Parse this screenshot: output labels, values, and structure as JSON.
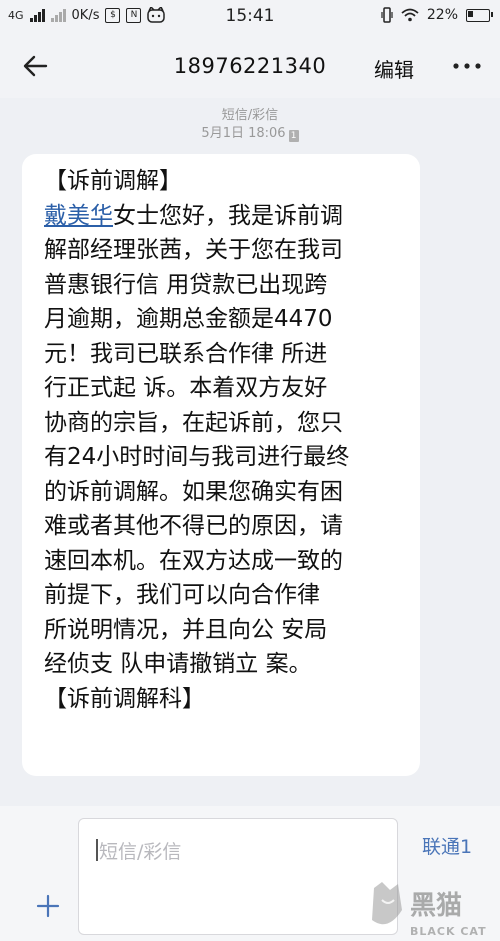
{
  "status_bar": {
    "network": "4G",
    "speed": "0K/s",
    "time": "15:41",
    "battery": "22%"
  },
  "header": {
    "phone_number": "18976221340",
    "edit_label": "编辑"
  },
  "message_meta": {
    "type": "短信/彩信",
    "timestamp": "5月1日 18:06",
    "sim_badge": "1"
  },
  "message": {
    "lines": [
      "【诉前调解】",
      "女士您好，我是诉前调",
      "解部经理张茜，关于您在我司",
      "普惠银行信 用贷款已出现跨",
      "月逾期，逾期总金额是4470",
      "元！我司已联系合作律 所进",
      "行正式起 诉。本着双方友好",
      "协商的宗旨，在起诉前，您只",
      "有24小时时间与我司进行最终",
      "的诉前调解。如果您确实有困",
      "难或者其他不得已的原因，请",
      "速回本机。在双方达成一致的",
      "前提下，我们可以向合作律",
      "所说明情况，并且向公 安局",
      "经侦支 队申请撤销立 案。",
      "【诉前调解科】"
    ],
    "name_link": "戴美华"
  },
  "composer": {
    "placeholder": "短信/彩信",
    "sim_label": "联通1"
  },
  "watermark": {
    "text_cn": "黑猫",
    "text_en": "BLACK CAT"
  },
  "colors": {
    "link": "#2b5fa8",
    "sim_accent": "#4a75b8",
    "background": "#eef0f4"
  }
}
